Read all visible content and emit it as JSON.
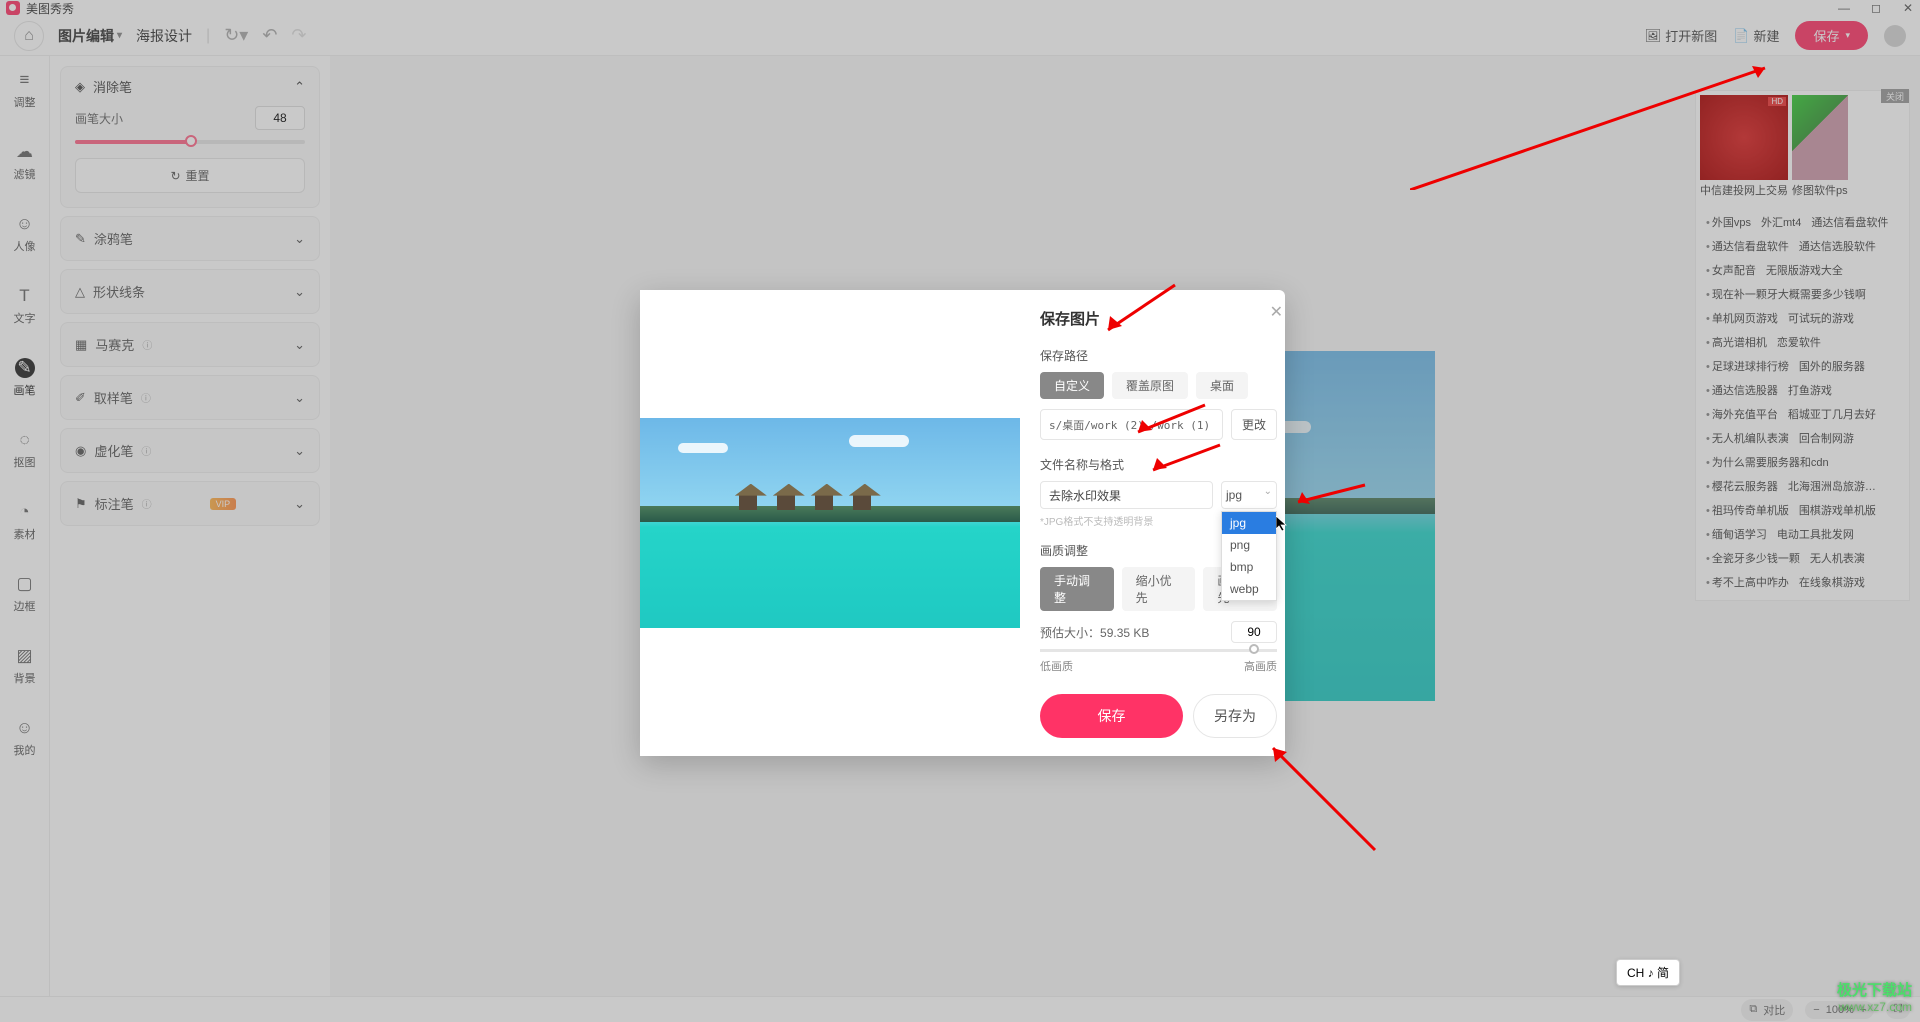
{
  "titlebar": {
    "app_name": "美图秀秀"
  },
  "toolbar": {
    "tab_edit": "图片编辑",
    "tab_poster": "海报设计",
    "open": "打开新图",
    "new": "新建",
    "save": "保存"
  },
  "sidebar": {
    "items": [
      {
        "label": "调整"
      },
      {
        "label": "滤镜"
      },
      {
        "label": "人像"
      },
      {
        "label": "文字"
      },
      {
        "label": "画笔"
      },
      {
        "label": "抠图"
      },
      {
        "label": "素材"
      },
      {
        "label": "边框"
      },
      {
        "label": "背景"
      },
      {
        "label": "我的"
      }
    ]
  },
  "toolpanel": {
    "eraser_title": "消除笔",
    "brush_size_label": "画笔大小",
    "brush_size_value": "48",
    "reset": "重置",
    "items": [
      {
        "label": "涂鸦笔"
      },
      {
        "label": "形状线条"
      },
      {
        "label": "马赛克"
      },
      {
        "label": "取样笔"
      },
      {
        "label": "虚化笔"
      },
      {
        "label": "标注笔"
      }
    ]
  },
  "modal": {
    "title": "保存图片",
    "path_label": "保存路径",
    "path_custom": "自定义",
    "path_overwrite": "覆盖原图",
    "path_desktop": "桌面",
    "path_value": "s/桌面/work (2) /work (1)",
    "change": "更改",
    "name_label": "文件名称与格式",
    "name_value": "去除水印效果",
    "format_selected": "jpg",
    "format_options": [
      "jpg",
      "png",
      "bmp",
      "webp"
    ],
    "hint": "*JPG格式不支持透明背景",
    "quality_label": "画质调整",
    "quality_manual": "手动调整",
    "quality_shrink": "缩小优先",
    "quality_pref": "画质优先",
    "est_label": "预估大小：",
    "est_value": "59.35 KB",
    "quality_value": "90",
    "low_q": "低画质",
    "high_q": "高画质",
    "save": "保存",
    "save_as": "另存为"
  },
  "ads": {
    "thumb1_cap": "中信建投网上交易",
    "thumb2_cap": "修图软件ps",
    "close": "关闭",
    "lines": [
      [
        "外国vps",
        "外汇mt4",
        "通达信看盘软件"
      ],
      [
        "通达信看盘软件",
        "通达信选股软件"
      ],
      [
        "女声配音",
        "无限版游戏大全"
      ],
      [
        "现在补一颗牙大概需要多少钱啊"
      ],
      [
        "单机网页游戏",
        "可试玩的游戏"
      ],
      [
        "高光谱相机",
        "恋爱软件"
      ],
      [
        "足球进球排行榜",
        "国外的服务器"
      ],
      [
        "通达信选股器",
        "打鱼游戏"
      ],
      [
        "海外充值平台",
        "稻城亚丁几月去好"
      ],
      [
        "无人机编队表演",
        "回合制网游"
      ],
      [
        "为什么需要服务器和cdn"
      ],
      [
        "樱花云服务器",
        "北海涠洲岛旅游…"
      ],
      [
        "祖玛传奇单机版",
        "围棋游戏单机版"
      ],
      [
        "缅甸语学习",
        "电动工具批发网"
      ],
      [
        "全瓷牙多少钱一颗",
        "无人机表演"
      ],
      [
        "考不上高中咋办",
        "在线象棋游戏"
      ]
    ]
  },
  "statusbar": {
    "compare": "对比",
    "zoom": "100%"
  },
  "ime": "CH ♪ 简",
  "watermark": {
    "line1": "极光下载站",
    "line2": "www.xz7.com"
  }
}
